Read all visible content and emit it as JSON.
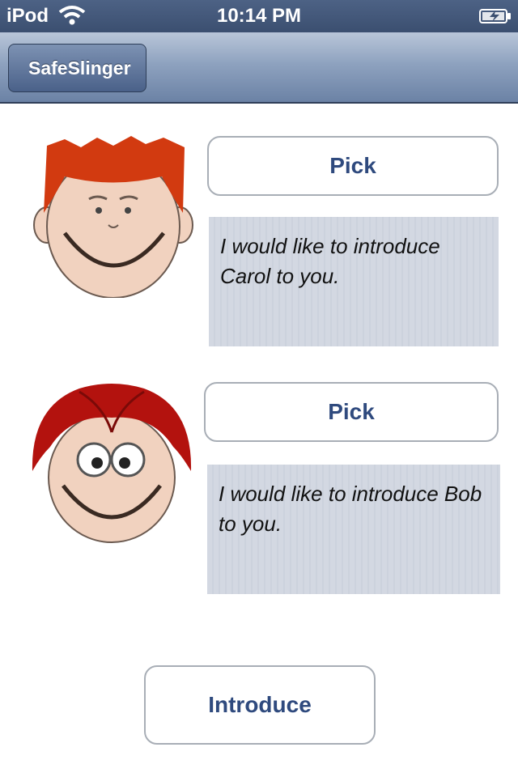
{
  "status_bar": {
    "carrier": "iPod",
    "time": "10:14 PM",
    "wifi_icon": "wifi-icon",
    "battery_icon": "battery-charging-icon"
  },
  "nav_bar": {
    "back_label": "SafeSlinger"
  },
  "contacts": [
    {
      "avatar_icon": "boy-red-spiky-hair-avatar",
      "pick_label": "Pick",
      "message": "I would like to introduce Carol  to you."
    },
    {
      "avatar_icon": "girl-red-hair-glasses-avatar",
      "pick_label": "Pick",
      "message": "I would like to introduce Bob  to you."
    }
  ],
  "introduce_label": "Introduce",
  "colors": {
    "nav_dark": "#3b4f70",
    "button_text": "#2f4a7e",
    "message_bg": "#d3d8e2"
  }
}
